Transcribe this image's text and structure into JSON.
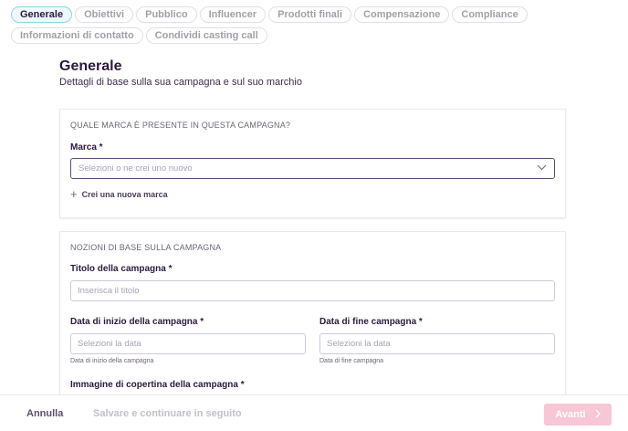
{
  "tabs": {
    "row1": [
      "Generale",
      "Obiettivi",
      "Pubblico",
      "Influencer",
      "Prodotti finali",
      "Compensazione",
      "Compliance"
    ],
    "row2": [
      "Informazioni di contatto",
      "Condividi casting call"
    ],
    "active": "Generale"
  },
  "header": {
    "title": "Generale",
    "subtitle": "Dettagli di base sulla sua campagna e sul suo marchio"
  },
  "brand_section": {
    "heading": "QUALE MARCA È PRESENTE IN QUESTA CAMPAGNA?",
    "brand_label": "Marca *",
    "brand_placeholder": "Selezioni o ne crei uno nuovo",
    "add_brand_label": "Crei una nuova marca"
  },
  "basics_section": {
    "heading": "NOZIONI DI BASE SULLA CAMPAGNA",
    "title_label": "Titolo della campagna *",
    "title_placeholder": "Inserisca il titolo",
    "start_label": "Data di inizio della campagna *",
    "start_placeholder": "Selezioni la data",
    "start_helper": "Data di inizio della campagna",
    "end_label": "Data di fine campagna *",
    "end_placeholder": "Selezioni la data",
    "end_helper": "Data di fine campagna",
    "cover_label": "Immagine di copertina della campagna *"
  },
  "footer": {
    "cancel": "Annulla",
    "save_later": "Salvare e continuare in seguito",
    "next": "Avanti"
  },
  "colors": {
    "accent_tab": "#8fd6e0",
    "next_button": "#f7c7d6",
    "text_primary": "#2b1a3d"
  },
  "icons": {
    "select_chevron": "chevron-down-icon",
    "add": "plus-icon",
    "next_chevron": "chevron-right-icon"
  }
}
